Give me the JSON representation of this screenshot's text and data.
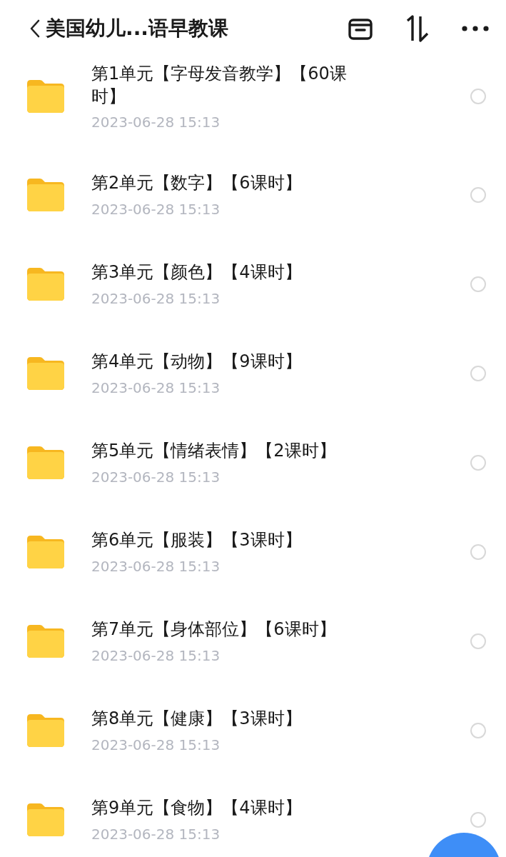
{
  "header": {
    "title": "美国幼儿...语早教课"
  },
  "files": [
    {
      "name": "第1单元【字母发音教学】【60课时】",
      "date": "2023-06-28 15:13",
      "selected": false
    },
    {
      "name": "第2单元【数字】【6课时】",
      "date": "2023-06-28 15:13",
      "selected": false
    },
    {
      "name": "第3单元【颜色】【4课时】",
      "date": "2023-06-28 15:13",
      "selected": false
    },
    {
      "name": "第4单元【动物】【9课时】",
      "date": "2023-06-28 15:13",
      "selected": false
    },
    {
      "name": "第5单元【情绪表情】【2课时】",
      "date": "2023-06-28 15:13",
      "selected": false
    },
    {
      "name": "第6单元【服装】【3课时】",
      "date": "2023-06-28 15:13",
      "selected": false
    },
    {
      "name": "第7单元【身体部位】【6课时】",
      "date": "2023-06-28 15:13",
      "selected": false
    },
    {
      "name": "第8单元【健康】【3课时】",
      "date": "2023-06-28 15:13",
      "selected": false
    },
    {
      "name": "第9单元【食物】【4课时】",
      "date": "2023-06-28 15:13",
      "selected": false
    }
  ]
}
